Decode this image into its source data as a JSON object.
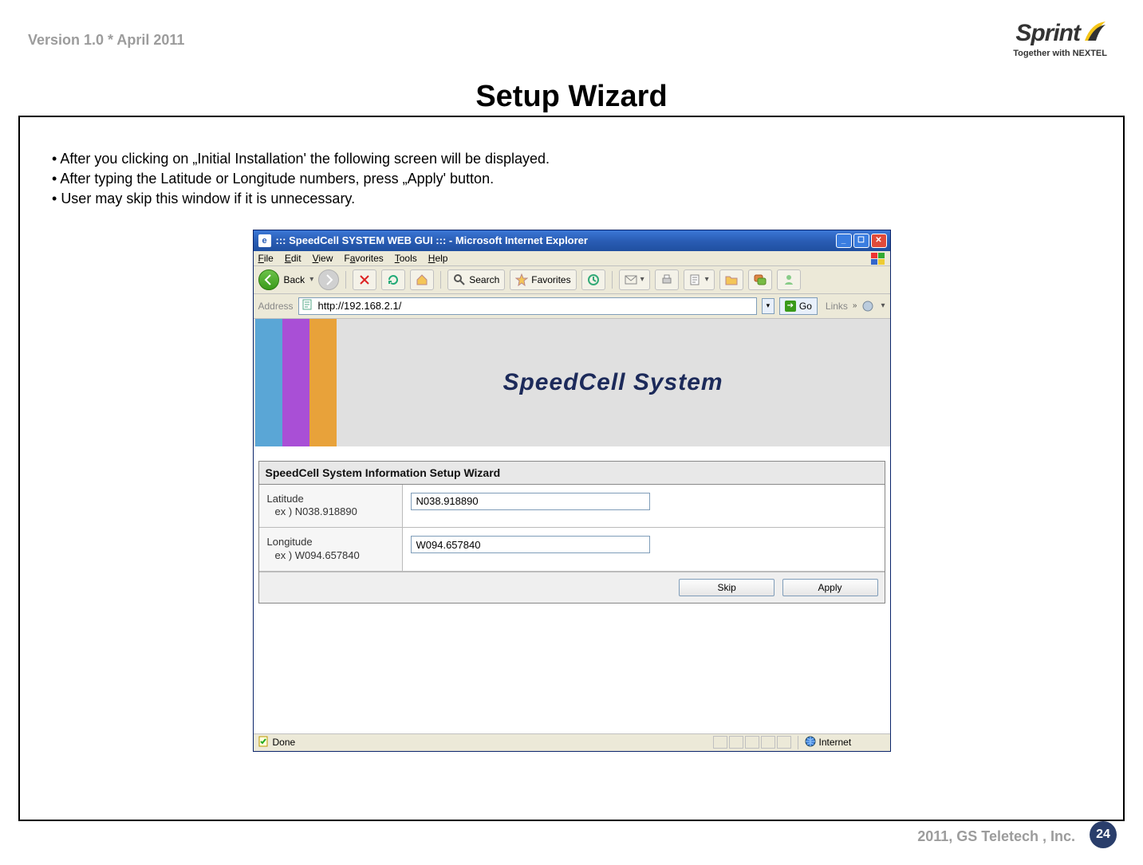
{
  "header": {
    "version_text": "Version 1.0 * April 2011",
    "logo_text": "Sprint",
    "tagline": "Together with NEXTEL"
  },
  "title": "Setup Wizard",
  "bullets": [
    "After you clicking on „Initial Installation' the following screen will be displayed.",
    "After typing the Latitude or Longitude numbers, press „Apply' button.",
    "User may skip this window if it is unnecessary."
  ],
  "browser": {
    "window_title": "::: SpeedCell SYSTEM WEB GUI ::: - Microsoft Internet Explorer",
    "menu": {
      "file": "File",
      "edit": "Edit",
      "view": "View",
      "favorites": "Favorites",
      "tools": "Tools",
      "help": "Help"
    },
    "toolbar": {
      "back": "Back",
      "search": "Search",
      "favorites": "Favorites"
    },
    "address": {
      "label": "Address",
      "url": "http://192.168.2.1/",
      "go": "Go",
      "links": "Links"
    },
    "banner_title": "SpeedCell System",
    "wizard": {
      "heading": "SpeedCell System Information Setup Wizard",
      "lat_label": "Latitude",
      "lat_example": "ex ) N038.918890",
      "lat_value": "N038.918890",
      "lon_label": "Longitude",
      "lon_example": "ex ) W094.657840",
      "lon_value": "W094.657840",
      "skip": "Skip",
      "apply": "Apply"
    },
    "status": {
      "done": "Done",
      "zone": "Internet"
    }
  },
  "footer": {
    "copyright": "2011, GS Teletech , Inc.",
    "page": "24"
  }
}
